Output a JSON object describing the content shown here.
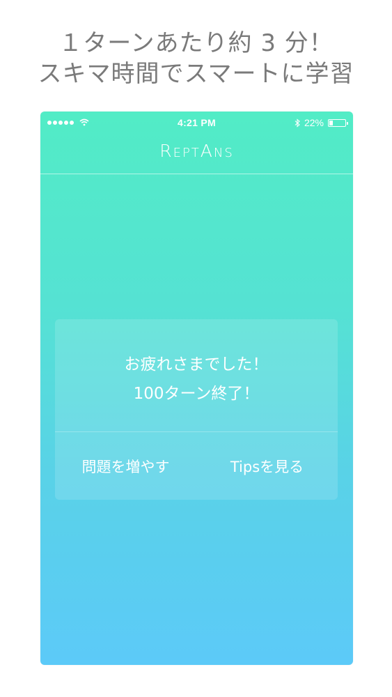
{
  "promo": {
    "line1": "１ターンあたり約 3 分！",
    "line2": "スキマ時間でスマートに学習"
  },
  "status_bar": {
    "time": "4:21 PM",
    "battery": "22%",
    "battery_level": 0.22,
    "signal_icon": "signal-dots-icon",
    "wifi_icon": "wifi-icon",
    "bluetooth_icon": "bluetooth-icon"
  },
  "nav": {
    "title": "ReptAns"
  },
  "dialog": {
    "line1": "お疲れさまでした！",
    "line2": "100ターン終了！",
    "left_button": "問題を増やす",
    "right_button": "Tipsを見る"
  },
  "colors": {
    "gradient_top": "#52ecc6",
    "gradient_bottom": "#5ccaf8",
    "promo_text": "#7a7a7a"
  }
}
